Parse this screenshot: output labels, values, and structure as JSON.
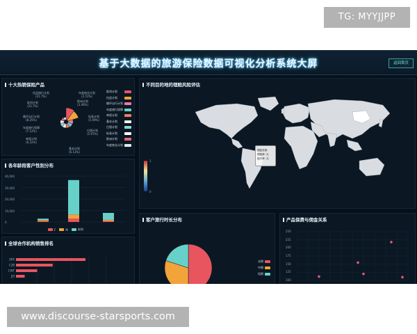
{
  "watermarks": {
    "top": "TG: MYYJJPP",
    "bottom": "www.discourse-starsports.com"
  },
  "header": {
    "title": "基于大数据的旅游保险数据可视化分析系统大屏",
    "back_button": "返回首页"
  },
  "panels": {
    "top_products": {
      "title": "十大热销保险产品",
      "rose_labels": [
        {
          "name": "年度商业计划",
          "pct": "(2.51%)"
        },
        {
          "name": "欧洲计划",
          "pct": "(3.46%)"
        },
        {
          "name": "标准计划",
          "pct": "(5.09%)"
        },
        {
          "name": "白银计划",
          "pct": "(5.97%)"
        },
        {
          "name": "基本计划",
          "pct": "(6.13%)"
        },
        {
          "name": "单程计划",
          "pct": "(6.22%)"
        },
        {
          "name": "年度旅行保障",
          "pct": "(7.12%)"
        },
        {
          "name": "循环出行计划",
          "pct": "(8.25%)"
        },
        {
          "name": "取消计划",
          "pct": "(23.7%)"
        },
        {
          "name": "往返旅行计划",
          "pct": "(21.7%)"
        }
      ],
      "legend": [
        {
          "label": "取消计划",
          "color": "#e8555f"
        },
        {
          "name_hidden": false,
          "label": "往返计划",
          "color": "#f2a33a"
        },
        {
          "label": "循环出行计划",
          "color": "#e879b0"
        },
        {
          "label": "年度旅行保障",
          "color": "#67d1c9"
        },
        {
          "label": "单程计划",
          "color": "#ee7f5c"
        },
        {
          "label": "基本计划",
          "color": "#f4f4f4"
        },
        {
          "label": "白银计划",
          "color": "#8fd6d2"
        },
        {
          "label": "标准计划",
          "color": "#ffffff"
        },
        {
          "label": "欧洲计划",
          "color": "#e2697a"
        },
        {
          "label": "年度商业计划",
          "color": "#d8f0f0"
        }
      ]
    },
    "age_gender": {
      "title": "各年龄段客户性别分布",
      "y_ticks": [
        "40,000",
        "30,000",
        "20,000",
        "10,000",
        "0"
      ],
      "legend": [
        {
          "label": "F",
          "color": "#e8555f"
        },
        {
          "label": "M",
          "color": "#f2a33a"
        },
        {
          "label": "未知",
          "color": "#67d1c9"
        }
      ]
    },
    "partners": {
      "title": "全球合作机构销售排名",
      "labels": [
        "EPX",
        "C2B",
        "CWT",
        "JZI"
      ]
    },
    "destinations": {
      "title": "不同目的地的理赔风险评估",
      "scale_top": "1",
      "scale_bottom": "0",
      "tooltip_lines": [
        "理赔总数:",
        "理赔率: 无",
        "赔付率: 无"
      ]
    },
    "duration": {
      "title": "客户旅行时长分布",
      "legend": [
        {
          "label": "长期",
          "color": "#e8555f"
        },
        {
          "label": "中期",
          "color": "#f2a33a"
        },
        {
          "label": "短期",
          "color": "#67d1c9"
        }
      ]
    },
    "premium": {
      "title": "产品保费与佣金关系",
      "y_ticks": [
        "250",
        "225",
        "200",
        "175",
        "150",
        "125",
        "100"
      ]
    }
  },
  "chart_data": [
    {
      "type": "pie",
      "variant": "rose",
      "categories": [
        "取消计划",
        "往返旅行计划",
        "循环出行计划",
        "年度旅行保障",
        "单程计划",
        "基本计划",
        "白银计划",
        "标准计划",
        "欧洲计划",
        "年度商业计划"
      ],
      "values": [
        23.7,
        21.7,
        8.25,
        7.12,
        6.22,
        6.13,
        5.97,
        5.09,
        3.46,
        2.51
      ]
    },
    {
      "type": "bar",
      "stacked": true,
      "categories": [
        "",
        "",
        ""
      ],
      "ylim": [
        0,
        40000
      ],
      "series": [
        {
          "name": "F",
          "values": [
            800,
            3000,
            900
          ]
        },
        {
          "name": "M",
          "values": [
            900,
            3500,
            1000
          ]
        },
        {
          "name": "未知",
          "values": [
            1200,
            30000,
            6000
          ]
        }
      ]
    },
    {
      "type": "bar",
      "orientation": "horizontal",
      "categories": [
        "EPX",
        "C2B",
        "CWT",
        "JZI"
      ],
      "values": [
        36000,
        19000,
        11000,
        4500
      ]
    },
    {
      "type": "pie",
      "categories": [
        "长期",
        "中期",
        "短期"
      ],
      "values": [
        50,
        30,
        20
      ]
    },
    {
      "type": "scatter",
      "ylim": [
        100,
        250
      ],
      "points": [
        [
          0.2,
          112
        ],
        [
          0.85,
          218
        ],
        [
          0.95,
          110
        ],
        [
          0.55,
          155
        ],
        [
          0.6,
          120
        ]
      ]
    }
  ]
}
